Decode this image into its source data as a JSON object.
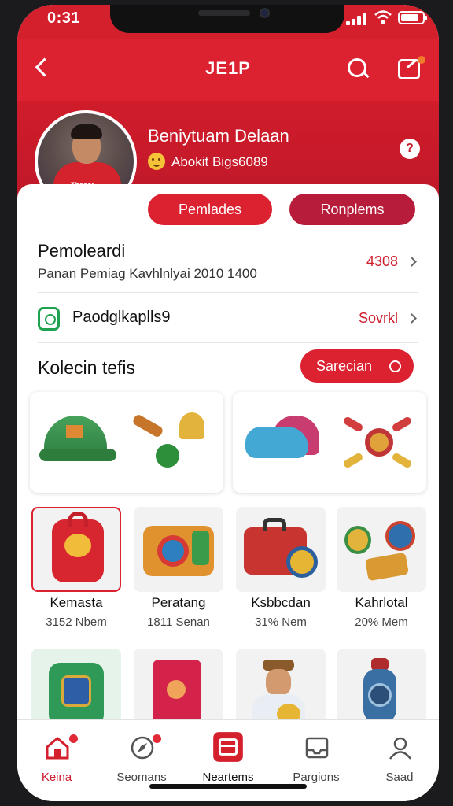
{
  "status_bar": {
    "time": "0:31"
  },
  "app": {
    "title": "JE1P"
  },
  "profile": {
    "name": "Beniytuam Delaan",
    "subtitle": "Abokit Bigs6089",
    "info_icon": "?",
    "avatar_shirt_text": "Thasor"
  },
  "actions": {
    "primary": "Pemlades",
    "secondary": "Ronplems"
  },
  "info_rows": [
    {
      "title": "Pemoleardi",
      "subtitle": "Panan Pemiag Kavhlnlyai 2010 1400",
      "value": "4308"
    },
    {
      "title": "Paodglkaplls9",
      "value": "Sovrkl"
    }
  ],
  "collection": {
    "title": "Kolecin tefis",
    "button": "Sarecian"
  },
  "grid": [
    {
      "name": "Kemasta",
      "price": "3152 Nbem"
    },
    {
      "name": "Peratang",
      "price": "1811 Senan"
    },
    {
      "name": "Ksbbcdan",
      "price": "31% Nem"
    },
    {
      "name": "Kahrlotal",
      "price": "20% Mem"
    }
  ],
  "bottom_nav": [
    {
      "label": "Keina",
      "icon": "home-icon"
    },
    {
      "label": "Seomans",
      "icon": "compass-icon"
    },
    {
      "label": "Neartems",
      "icon": "inbox-icon"
    },
    {
      "label": "Pargions",
      "icon": "tray-icon"
    },
    {
      "label": "Saad",
      "icon": "user-icon"
    }
  ],
  "colors": {
    "brand_red": "#dc2130",
    "dark_red": "#b71c3a",
    "green": "#1ea24f"
  }
}
